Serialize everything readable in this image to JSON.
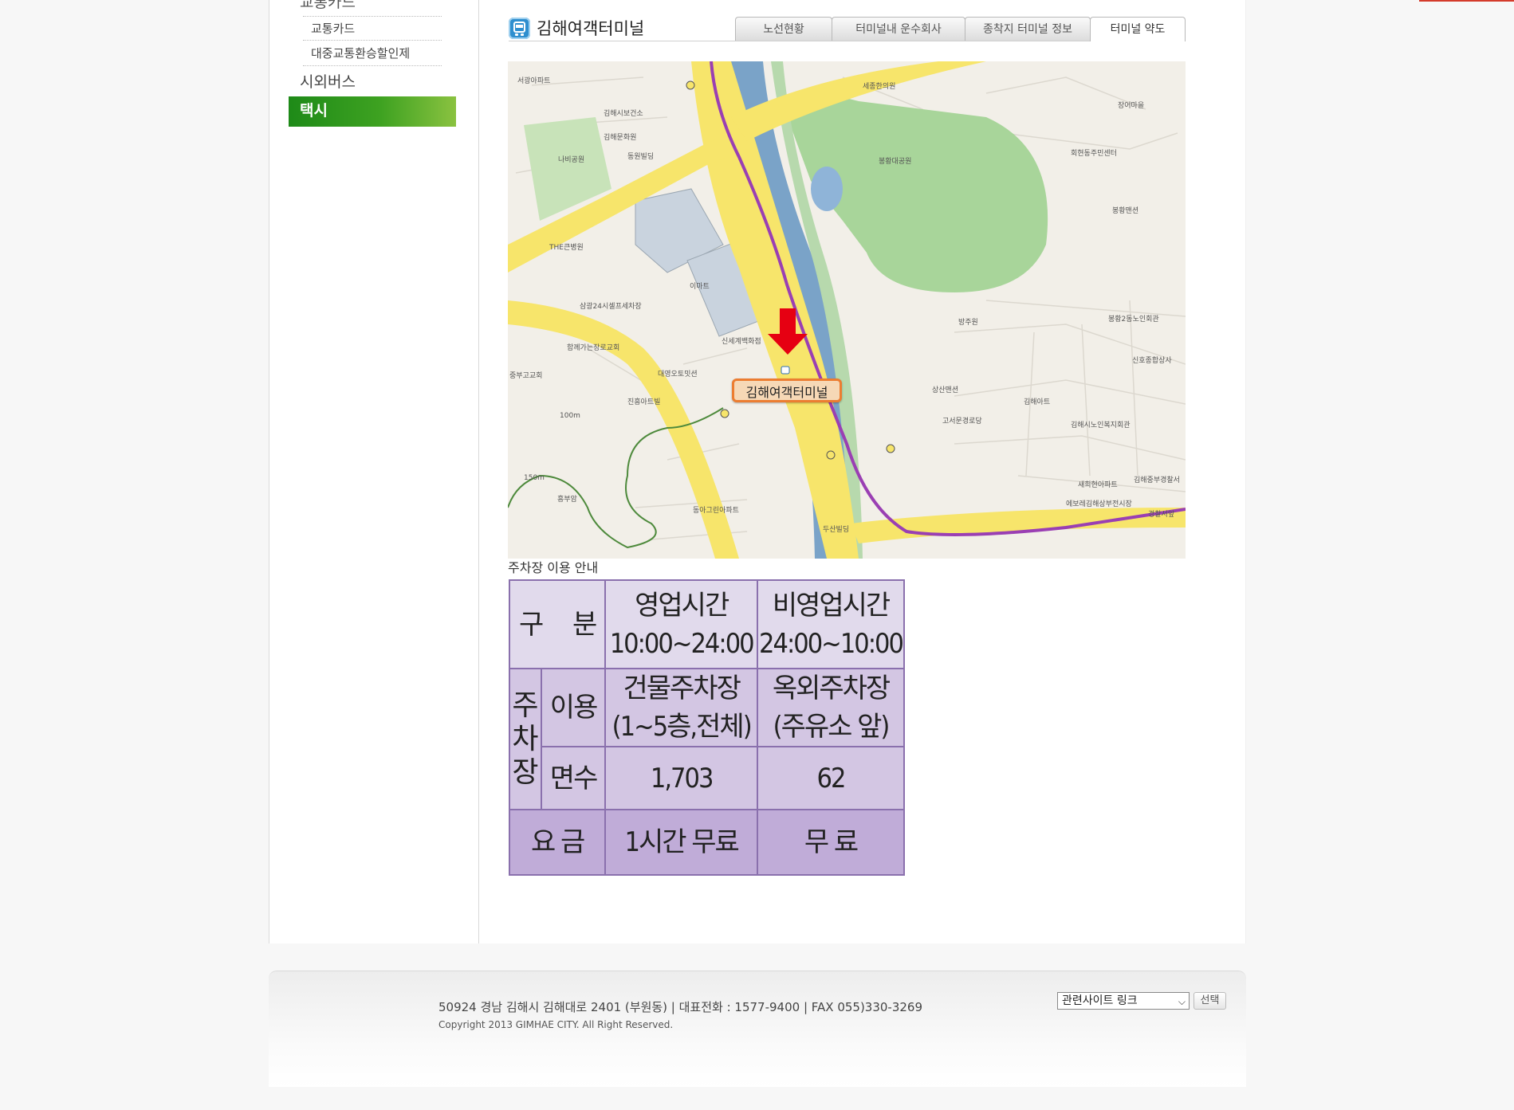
{
  "sidebar": {
    "top_cut": "교통카드",
    "subitems": [
      "교통카드",
      "대중교통환승할인제"
    ],
    "items": [
      {
        "label": "시외버스",
        "active": false
      },
      {
        "label": "택시",
        "active": true
      }
    ]
  },
  "header": {
    "title": "김해여객터미널",
    "tabs": [
      "노선현황",
      "터미널내 운수회사",
      "종착지 터미널 정보",
      "터미널 약도"
    ],
    "active_tab": "터미널 약도"
  },
  "map": {
    "terminal_label": "김해여객터미널",
    "places": [
      "서광아파트",
      "김해시보건소",
      "김해문화원",
      "동원빌딩",
      "나비공원",
      "THE큰병원",
      "이마트",
      "신세계백화점",
      "대영오토밋션",
      "진흥아트빌",
      "흥부암",
      "동아그린아파트",
      "두산빌딩",
      "세종한의원",
      "봉황대공원",
      "장어마을",
      "회현동주민센터",
      "봉황맨션",
      "봉황2동노인회관",
      "신호종합상사",
      "방주원",
      "상산맨션",
      "김해아트",
      "고서문경로당",
      "김해시노인복지회관",
      "새희현아파트",
      "김해중부경찰서",
      "에보레김해상부전시장",
      "경찰서앞",
      "삼광24시셀프세차장",
      "함께가는장로교회",
      "중부고교회",
      "100m",
      "150m"
    ]
  },
  "parking": {
    "caption": "주차장 이용 안내",
    "header": {
      "gubun": "구 분",
      "col1": [
        "영업시간",
        "10:00~24:00"
      ],
      "col2": [
        "비영업시간",
        "24:00~10:00"
      ]
    },
    "group_label": [
      "주",
      "차",
      "장"
    ],
    "rows": [
      {
        "label": "이용",
        "col1": [
          "건물주차장",
          "(1~5층,전체)"
        ],
        "col2": [
          "옥외주차장",
          "(주유소 앞)"
        ]
      },
      {
        "label": "면수",
        "col1": "1,703",
        "col2": "62"
      }
    ],
    "fee": {
      "label": "요 금",
      "col1": "1시간 무료",
      "col2": "무 료"
    }
  },
  "footer": {
    "address": "50924 경남 김해시 김해대로 2401 (부원동) | 대표전화 : 1577-9400 | FAX 055)330-3269",
    "copyright": "Copyright 2013 GIMHAE CITY. All Right Reserved.",
    "select_value": "관련사이트 링크",
    "select_button": "선택"
  },
  "colors": {
    "active_menu": "#3ea221",
    "table_border": "#8a70ad",
    "tag_border": "#ec7d31",
    "arrow": "#e60012"
  }
}
